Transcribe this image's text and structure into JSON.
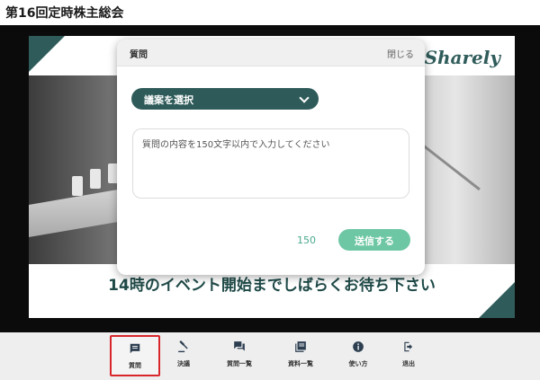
{
  "page": {
    "title": "第16回定時株主総会"
  },
  "slide": {
    "logo": "Sharely",
    "message": "14時のイベント開始までしばらくお待ち下さい"
  },
  "modal": {
    "title": "質問",
    "close_label": "閉じる",
    "agenda_select": {
      "value": "議案を選択"
    },
    "question_input": {
      "placeholder": "質問の内容を150文字以内で入力してください"
    },
    "char_count": "150",
    "send_label": "送信する"
  },
  "toolbar": {
    "items": [
      {
        "label": "質問",
        "icon": "chat-icon"
      },
      {
        "label": "決議",
        "icon": "gavel-icon"
      },
      {
        "label": "質問一覧",
        "icon": "forum-icon"
      },
      {
        "label": "資料一覧",
        "icon": "library-icon"
      },
      {
        "label": "使い方",
        "icon": "info-icon"
      },
      {
        "label": "退出",
        "icon": "logout-icon"
      }
    ]
  },
  "colors": {
    "accent": "#2e5b59",
    "send": "#6ec7a4",
    "active_outline": "#d9262b"
  }
}
